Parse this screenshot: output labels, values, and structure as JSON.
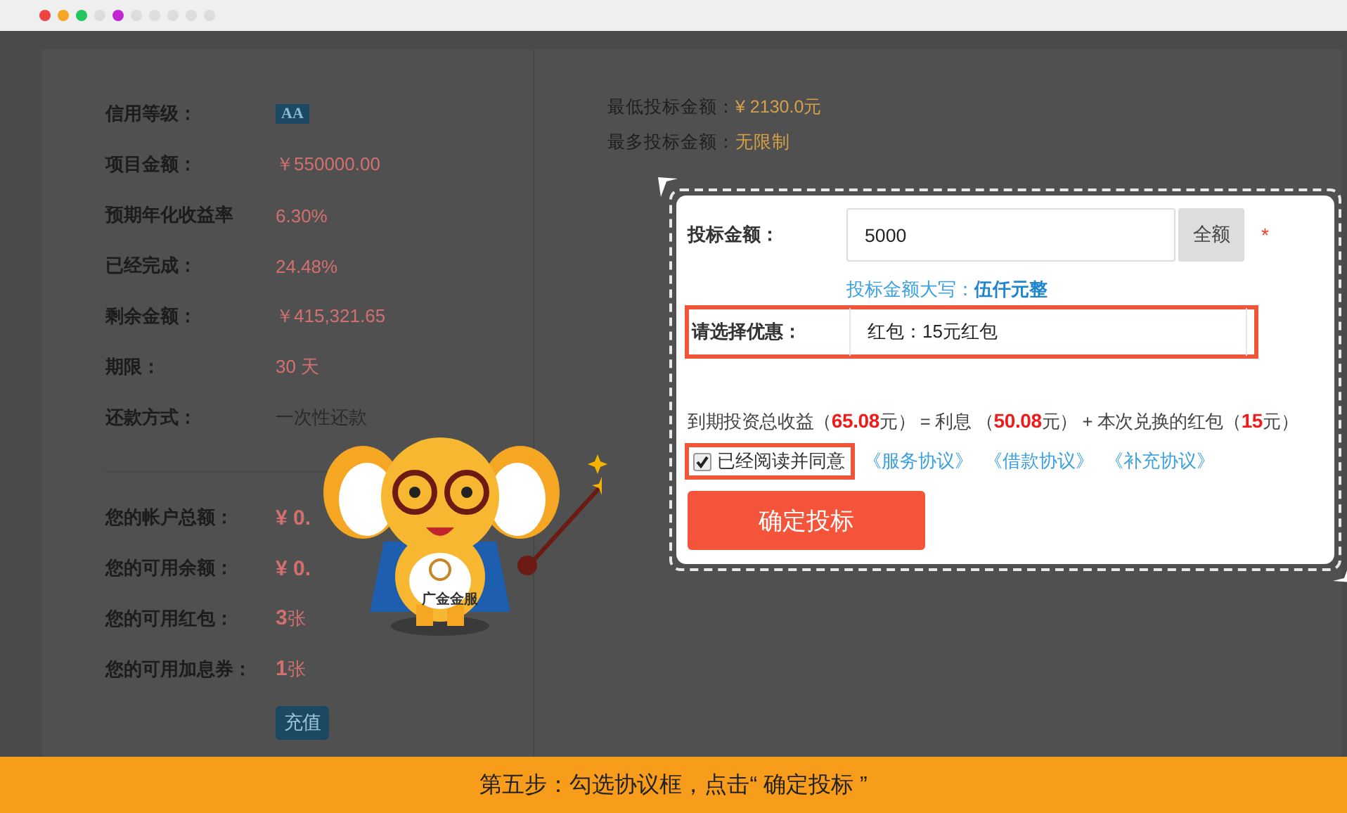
{
  "window_controls": [
    {
      "color": "#ef4444"
    },
    {
      "color": "#f5a623"
    },
    {
      "color": "#22c55e"
    },
    {
      "color": "#dddddd"
    },
    {
      "color": "#c026d3"
    },
    {
      "color": "#dddddd"
    },
    {
      "color": "#dddddd"
    },
    {
      "color": "#dddddd"
    },
    {
      "color": "#dddddd"
    },
    {
      "color": "#dddddd"
    }
  ],
  "project_info": [
    {
      "label": "信用等级：",
      "value": "AA",
      "kind": "badge"
    },
    {
      "label": "项目金额：",
      "value": "￥550000.00",
      "kind": "text"
    },
    {
      "label": "预期年化收益率",
      "value": "6.30%",
      "kind": "text"
    },
    {
      "label": "已经完成：",
      "value": "24.48%",
      "kind": "text"
    },
    {
      "label": "剩余金额：",
      "value": "￥415,321.65",
      "kind": "text"
    },
    {
      "label": "期限：",
      "value": "30 天",
      "kind": "text"
    },
    {
      "label": "还款方式：",
      "value": "一次性还款",
      "kind": "plain"
    }
  ],
  "account_info": [
    {
      "label": "您的帐户总额：",
      "value": "**¥ 0.**"
    },
    {
      "label": "您的可用余额：",
      "value": "**¥ 0.**"
    },
    {
      "label": "您的可用红包：",
      "value": "**3**张"
    },
    {
      "label": "您的可用加息券：",
      "value": "**1**张"
    }
  ],
  "recharge_button": "充值",
  "limits": [
    {
      "label": "最低投标金额：",
      "value": "¥ 2130.0元"
    },
    {
      "label": "最多投标金额：",
      "value": "无限制"
    }
  ],
  "form": {
    "amount_label": "投标金额：",
    "amount_value": "5000",
    "full_button": "全额",
    "required_mark": "*",
    "uppercase": "投标金额大写：**伍仟元整**",
    "discount_label": "请选择优惠：",
    "discount_value": "红包：15元红包",
    "earnings": "到期投资总收益（**65.08**元） = 利息 （**50.08**元） + 本次兑换的红包（**15**元）",
    "agree": {
      "label": "已经阅读并同意",
      "checked": true
    },
    "agreements": [
      "《服务协议》",
      "《借款协议》",
      "《补充协议》"
    ],
    "submit": "确定投标"
  },
  "mascot": {
    "badge_text": "广金金服"
  },
  "caption": "第五步：勾选协议框，点击“ 确定投标 ”"
}
